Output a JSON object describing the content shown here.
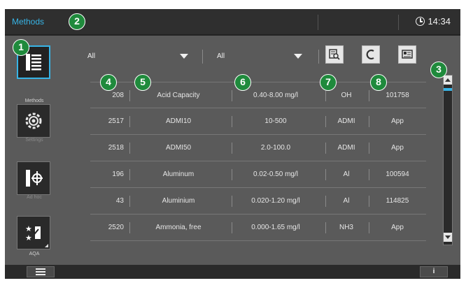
{
  "header": {
    "title": "Methods",
    "time": "14:34"
  },
  "sidebar": {
    "items": [
      {
        "label": "Methods",
        "icon": "methods-icon"
      },
      {
        "label": "Settings",
        "icon": "settings-gear-icon"
      },
      {
        "label": "Ad hoc",
        "icon": "adhoc-icon"
      },
      {
        "label": "AQA",
        "icon": "aqa-icon"
      }
    ]
  },
  "filters": {
    "filter1": "All",
    "filter2": "All"
  },
  "tools": [
    "search-list-icon",
    "reset-c-icon",
    "details-icon"
  ],
  "table": {
    "rows": [
      {
        "id": "208",
        "name": "Acid Capacity",
        "range": "0.40-8.00 mg/l",
        "symbol": "OH",
        "code": "101758"
      },
      {
        "id": "2517",
        "name": "ADMI10",
        "range": "10-500",
        "symbol": "ADMI",
        "code": "App"
      },
      {
        "id": "2518",
        "name": "ADMI50",
        "range": "2.0-100.0",
        "symbol": "ADMI",
        "code": "App"
      },
      {
        "id": "196",
        "name": "Aluminum",
        "range": "0.02-0.50 mg/l",
        "symbol": "Al",
        "code": "100594"
      },
      {
        "id": "43",
        "name": "Aluminium",
        "range": "0.020-1.20 mg/l",
        "symbol": "Al",
        "code": "114825"
      },
      {
        "id": "2520",
        "name": "Ammonia, free",
        "range": "0.000-1.65 mg/l",
        "symbol": "NH3",
        "code": "App"
      }
    ]
  },
  "callouts": [
    "1",
    "2",
    "3",
    "4",
    "5",
    "6",
    "7",
    "8"
  ],
  "colors": {
    "accent": "#37b4e6",
    "callout": "#1f8a3c",
    "panel": "#5a5a5a",
    "bar": "#2f2f2f"
  }
}
